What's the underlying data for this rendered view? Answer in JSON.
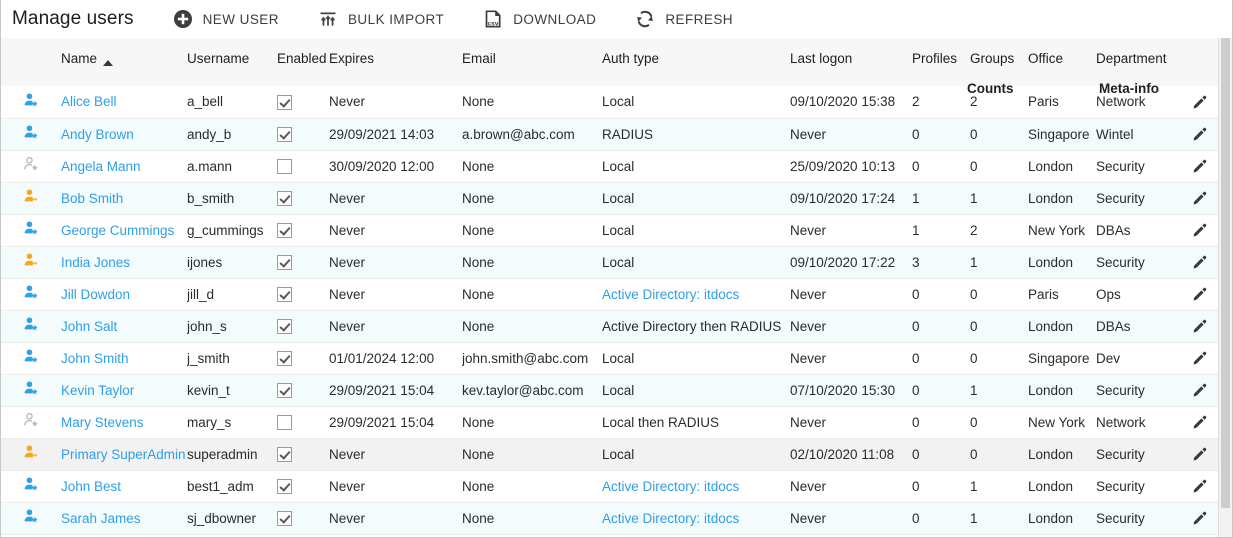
{
  "header": {
    "title": "Manage users",
    "actions": [
      {
        "label": "NEW USER",
        "icon": "plus-circle-icon"
      },
      {
        "label": "BULK IMPORT",
        "icon": "bulk-import-icon"
      },
      {
        "label": "DOWNLOAD",
        "icon": "csv-file-icon"
      },
      {
        "label": "REFRESH",
        "icon": "refresh-icon"
      }
    ]
  },
  "table": {
    "group_headers": [
      {
        "label": "Counts"
      },
      {
        "label": "Meta-info"
      }
    ],
    "columns": [
      {
        "key": "usericon",
        "label": ""
      },
      {
        "key": "name",
        "label": "Name",
        "sorted": "asc"
      },
      {
        "key": "username",
        "label": "Username"
      },
      {
        "key": "enabled",
        "label": "Enabled"
      },
      {
        "key": "expires",
        "label": "Expires"
      },
      {
        "key": "email",
        "label": "Email"
      },
      {
        "key": "authtype",
        "label": "Auth type"
      },
      {
        "key": "lastlogon",
        "label": "Last logon"
      },
      {
        "key": "profiles",
        "label": "Profiles"
      },
      {
        "key": "groups",
        "label": "Groups"
      },
      {
        "key": "office",
        "label": "Office"
      },
      {
        "key": "department",
        "label": "Department"
      },
      {
        "key": "edit",
        "label": ""
      }
    ],
    "rows": [
      {
        "icon_type": "user-enabled",
        "name": "Alice Bell",
        "username": "a_bell",
        "enabled": true,
        "expires": "Never",
        "email": "None",
        "authtype": "Local",
        "auth_link": false,
        "lastlogon": "09/10/2020 15:38",
        "profiles": "2",
        "groups": "2",
        "office": "Paris",
        "department": "Network"
      },
      {
        "icon_type": "user-enabled",
        "name": "Andy Brown",
        "username": "andy_b",
        "enabled": true,
        "expires": "29/09/2021 14:03",
        "email": "a.brown@abc.com",
        "authtype": "RADIUS",
        "auth_link": false,
        "lastlogon": "Never",
        "profiles": "0",
        "groups": "0",
        "office": "Singapore",
        "department": "Wintel"
      },
      {
        "icon_type": "user-disabled",
        "name": "Angela Mann",
        "username": "a.mann",
        "enabled": false,
        "expires": "30/09/2020 12:00",
        "email": "None",
        "authtype": "Local",
        "auth_link": false,
        "lastlogon": "25/09/2020 10:13",
        "profiles": "0",
        "groups": "0",
        "office": "London",
        "department": "Security"
      },
      {
        "icon_type": "user-admin",
        "name": "Bob Smith",
        "username": "b_smith",
        "enabled": true,
        "expires": "Never",
        "email": "None",
        "authtype": "Local",
        "auth_link": false,
        "lastlogon": "09/10/2020 17:24",
        "profiles": "1",
        "groups": "1",
        "office": "London",
        "department": "Security"
      },
      {
        "icon_type": "user-enabled",
        "name": "George Cummings",
        "username": "g_cummings",
        "enabled": true,
        "expires": "Never",
        "email": "None",
        "authtype": "Local",
        "auth_link": false,
        "lastlogon": "Never",
        "profiles": "1",
        "groups": "2",
        "office": "New York",
        "department": "DBAs"
      },
      {
        "icon_type": "user-admin",
        "name": "India Jones",
        "username": "ijones",
        "enabled": true,
        "expires": "Never",
        "email": "None",
        "authtype": "Local",
        "auth_link": false,
        "lastlogon": "09/10/2020 17:22",
        "profiles": "3",
        "groups": "1",
        "office": "London",
        "department": "Security"
      },
      {
        "icon_type": "user-enabled",
        "name": "Jill Dowdon",
        "username": "jill_d",
        "enabled": true,
        "expires": "Never",
        "email": "None",
        "authtype": "Active Directory: itdocs",
        "auth_link": true,
        "lastlogon": "Never",
        "profiles": "0",
        "groups": "0",
        "office": "Paris",
        "department": "Ops"
      },
      {
        "icon_type": "user-enabled",
        "name": "John Salt",
        "username": "john_s",
        "enabled": true,
        "expires": "Never",
        "email": "None",
        "authtype": "Active Directory then RADIUS",
        "auth_link": false,
        "lastlogon": "Never",
        "profiles": "0",
        "groups": "0",
        "office": "London",
        "department": "DBAs"
      },
      {
        "icon_type": "user-enabled",
        "name": "John Smith",
        "username": "j_smith",
        "enabled": true,
        "expires": "01/01/2024 12:00",
        "email": "john.smith@abc.com",
        "authtype": "Local",
        "auth_link": false,
        "lastlogon": "Never",
        "profiles": "0",
        "groups": "0",
        "office": "Singapore",
        "department": "Dev"
      },
      {
        "icon_type": "user-enabled",
        "name": "Kevin Taylor",
        "username": "kevin_t",
        "enabled": true,
        "expires": "29/09/2021 15:04",
        "email": "kev.taylor@abc.com",
        "authtype": "Local",
        "auth_link": false,
        "lastlogon": "07/10/2020 15:30",
        "profiles": "0",
        "groups": "1",
        "office": "London",
        "department": "Security"
      },
      {
        "icon_type": "user-disabled",
        "name": "Mary Stevens",
        "username": "mary_s",
        "enabled": false,
        "expires": "29/09/2021 15:04",
        "email": "None",
        "authtype": "Local then RADIUS",
        "auth_link": false,
        "lastlogon": "Never",
        "profiles": "0",
        "groups": "0",
        "office": "New York",
        "department": "Network"
      },
      {
        "icon_type": "user-admin",
        "name": "Primary SuperAdmin",
        "username": "superadmin",
        "enabled": true,
        "expires": "Never",
        "email": "None",
        "authtype": "Local",
        "auth_link": false,
        "lastlogon": "02/10/2020 11:08",
        "profiles": "0",
        "groups": "0",
        "office": "London",
        "department": "Security"
      },
      {
        "icon_type": "user-enabled",
        "name": "John Best",
        "username": "best1_adm",
        "enabled": true,
        "expires": "Never",
        "email": "None",
        "authtype": "Active Directory: itdocs",
        "auth_link": true,
        "lastlogon": "Never",
        "profiles": "0",
        "groups": "1",
        "office": "London",
        "department": "Security"
      },
      {
        "icon_type": "user-enabled",
        "name": "Sarah James",
        "username": "sj_dbowner",
        "enabled": true,
        "expires": "Never",
        "email": "None",
        "authtype": "Active Directory: itdocs",
        "auth_link": true,
        "lastlogon": "Never",
        "profiles": "0",
        "groups": "1",
        "office": "London",
        "department": "Security"
      }
    ]
  },
  "colors": {
    "link": "#2f9fe8",
    "admin_icon": "#f5a623",
    "user_icon": "#2f9fe8",
    "disabled_icon": "#b5b5b5",
    "row_alt": "#f4fbfc",
    "row_hover": "#f2f2f2",
    "header_bg": "#f7f7f7"
  }
}
